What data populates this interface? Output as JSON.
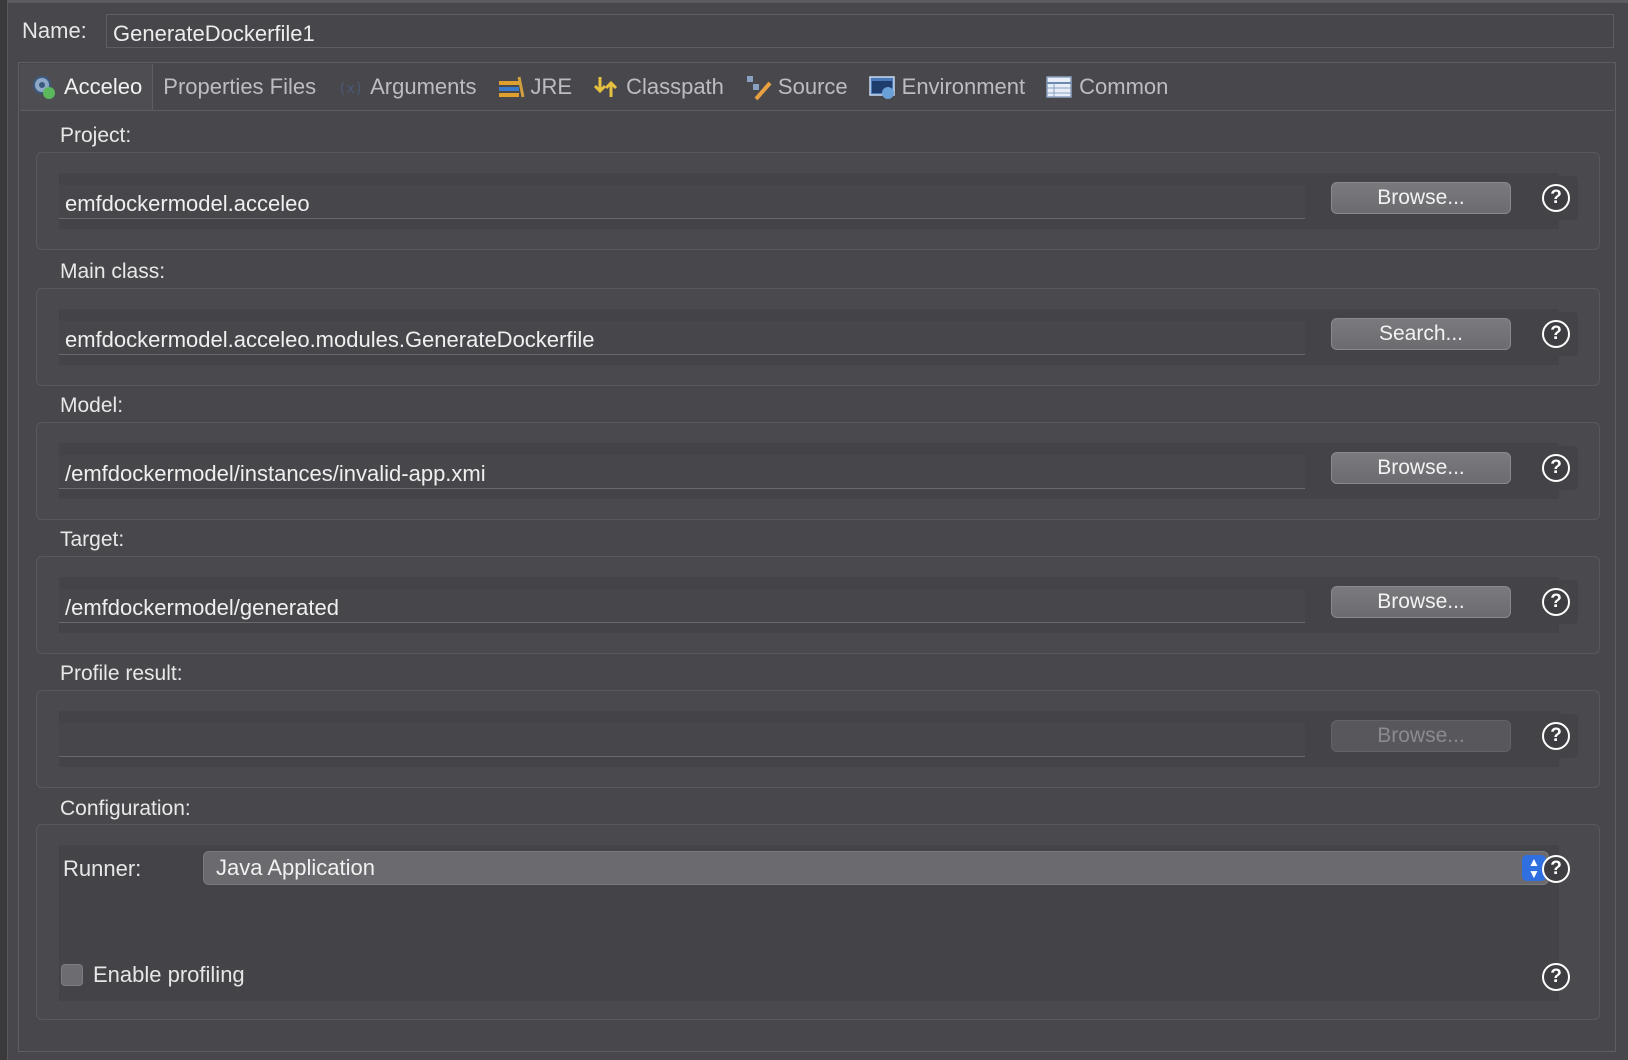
{
  "name": {
    "label": "Name:",
    "value": "GenerateDockerfile1"
  },
  "tabs": [
    {
      "label": "Acceleo",
      "icon": "acceleo-icon",
      "active": true
    },
    {
      "label": "Properties Files",
      "icon": "",
      "active": false
    },
    {
      "label": "Arguments",
      "icon": "arguments-icon",
      "active": false
    },
    {
      "label": "JRE",
      "icon": "jre-icon",
      "active": false
    },
    {
      "label": "Classpath",
      "icon": "classpath-icon",
      "active": false
    },
    {
      "label": "Source",
      "icon": "source-icon",
      "active": false
    },
    {
      "label": "Environment",
      "icon": "environment-icon",
      "active": false
    },
    {
      "label": "Common",
      "icon": "common-icon",
      "active": false
    }
  ],
  "project": {
    "label": "Project:",
    "value": "emfdockermodel.acceleo",
    "button": "Browse..."
  },
  "main_class": {
    "label": "Main class:",
    "value": "emfdockermodel.acceleo.modules.GenerateDockerfile",
    "button": "Search..."
  },
  "model": {
    "label": "Model:",
    "value": "/emfdockermodel/instances/invalid-app.xmi",
    "button": "Browse..."
  },
  "target": {
    "label": "Target:",
    "value": "/emfdockermodel/generated",
    "button": "Browse..."
  },
  "profile_result": {
    "label": "Profile result:",
    "value": "",
    "button": "Browse..."
  },
  "configuration": {
    "label": "Configuration:",
    "runner_label": "Runner:",
    "runner_value": "Java Application",
    "enable_profiling_label": "Enable profiling",
    "enable_profiling_checked": false
  },
  "help_glyph": "?",
  "colors": {
    "accent": "#2f6fe0",
    "background": "#48484c"
  }
}
